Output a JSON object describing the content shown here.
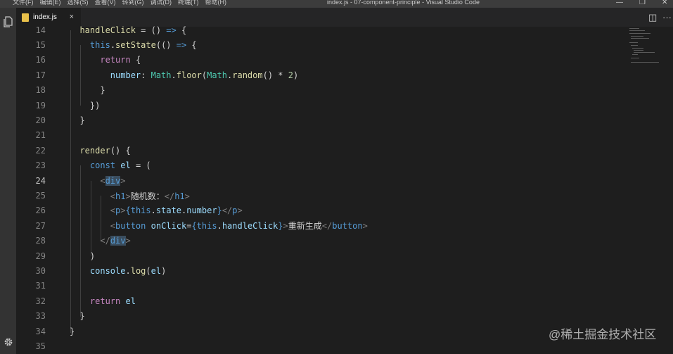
{
  "window": {
    "menu": [
      "文件(F)",
      "编辑(E)",
      "选择(S)",
      "查看(V)",
      "转到(G)",
      "调试(D)",
      "终端(T)",
      "帮助(H)"
    ],
    "title": "index.js - 07-component-principle - Visual Studio Code",
    "controls": {
      "minimize": "—",
      "maximize": "❐",
      "close": "✕"
    }
  },
  "tabs": [
    {
      "label": "index.js",
      "close": "×",
      "active": true
    }
  ],
  "tabbar_actions": {
    "split": "◫",
    "more": "···"
  },
  "editor": {
    "active_line": 24,
    "lines": [
      {
        "num": "14",
        "code": "  handleClick = () => {"
      },
      {
        "num": "15",
        "code": "    this.setState(() => {"
      },
      {
        "num": "16",
        "code": "      return {"
      },
      {
        "num": "17",
        "code": "        number: Math.floor(Math.random() * 2)"
      },
      {
        "num": "18",
        "code": "      }"
      },
      {
        "num": "19",
        "code": "    })"
      },
      {
        "num": "20",
        "code": "  }"
      },
      {
        "num": "21",
        "code": ""
      },
      {
        "num": "22",
        "code": "  render() {"
      },
      {
        "num": "23",
        "code": "    const el = ("
      },
      {
        "num": "24",
        "code": "      <div>"
      },
      {
        "num": "25",
        "code": "        <h1>随机数：</h1>"
      },
      {
        "num": "26",
        "code": "        <p>{this.state.number}</p>"
      },
      {
        "num": "27",
        "code": "        <button onClick={this.handleClick}>重新生成</button>"
      },
      {
        "num": "28",
        "code": "      </div>"
      },
      {
        "num": "29",
        "code": "    )"
      },
      {
        "num": "30",
        "code": "    console.log(el)"
      },
      {
        "num": "31",
        "code": ""
      },
      {
        "num": "32",
        "code": "    return el"
      },
      {
        "num": "33",
        "code": "  }"
      },
      {
        "num": "34",
        "code": "}"
      },
      {
        "num": "35",
        "code": ""
      }
    ]
  },
  "watermark": "@稀土掘金技术社区",
  "colors": {
    "keyword": "#569cd6",
    "control": "#c586c0",
    "function": "#dcdcaa",
    "variable": "#9cdcfe",
    "class": "#4ec9b0",
    "number": "#b5cea8",
    "tab_file_icon": "#e8c04a"
  },
  "icons": [
    "explorer-icon",
    "settings-gear-icon",
    "javascript-file-icon",
    "split-editor-icon",
    "more-actions-icon"
  ]
}
